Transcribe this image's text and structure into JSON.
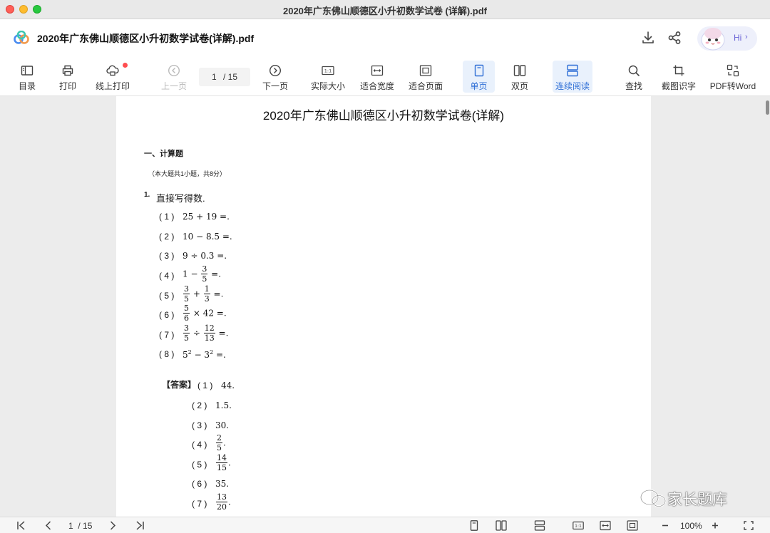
{
  "window": {
    "title": "2020年广东佛山顺德区小升初数学试卷 (详解).pdf"
  },
  "appbar": {
    "doc_title": "2020年广东佛山顺德区小升初数学试卷(详解).pdf",
    "hi_label": "Hi",
    "hi_chevron": "›"
  },
  "toolbar": {
    "toc": "目录",
    "print": "打印",
    "online_print": "线上打印",
    "prev": "上一页",
    "page_current": "1",
    "page_total": "/ 15",
    "next": "下一页",
    "actual_size": "实际大小",
    "fit_width": "适合宽度",
    "fit_page": "适合页面",
    "single": "单页",
    "double": "双页",
    "continuous": "连续阅读",
    "find": "查找",
    "ocr": "截图识字",
    "to_word": "PDF转Word",
    "accent": "#2f6fd6"
  },
  "doc": {
    "title": "2020年广东佛山顺德区小升初数学试卷(详解)",
    "section": "一、计算题",
    "note": "（本大题共1小题，共8分）",
    "q_num": "1.",
    "q_text": "直接写得数.",
    "problems": [
      {
        "n": "( 1 )",
        "expr": "25 + 19 =."
      },
      {
        "n": "( 2 )",
        "expr": "10 − 8.5 =."
      },
      {
        "n": "( 3 )",
        "expr": "9 ÷ 0.3 =."
      },
      {
        "n": "( 4 )",
        "a": "1 −",
        "f1": [
          "3",
          "5"
        ],
        "b": "=."
      },
      {
        "n": "( 5 )",
        "f1": [
          "3",
          "5"
        ],
        "a": "+",
        "f2": [
          "1",
          "3"
        ],
        "b": "=."
      },
      {
        "n": "( 6 )",
        "f1": [
          "5",
          "6"
        ],
        "a": "× 42 =."
      },
      {
        "n": "( 7 )",
        "f1": [
          "3",
          "5"
        ],
        "a": "÷",
        "f2": [
          "12",
          "13"
        ],
        "b": "=."
      },
      {
        "n": "( 8 )",
        "base1": "5",
        "exp1": "2",
        "mid": "− 3",
        "exp2": "2",
        "b": "=."
      }
    ],
    "answer_label": "【答案】",
    "answers": [
      {
        "n": "( 1 )",
        "v": "44."
      },
      {
        "n": "( 2 )",
        "v": "1.5."
      },
      {
        "n": "( 3 )",
        "v": "30."
      },
      {
        "n": "( 4 )",
        "f": [
          "2",
          "5"
        ],
        "v": "."
      },
      {
        "n": "( 5 )",
        "f": [
          "14",
          "15"
        ],
        "v": "."
      },
      {
        "n": "( 6 )",
        "v": "35."
      },
      {
        "n": "( 7 )",
        "f": [
          "13",
          "20"
        ],
        "v": "."
      }
    ]
  },
  "watermark": "家长题库",
  "statusbar": {
    "page_current": "1",
    "page_total": "/ 15",
    "zoom": "100%"
  }
}
